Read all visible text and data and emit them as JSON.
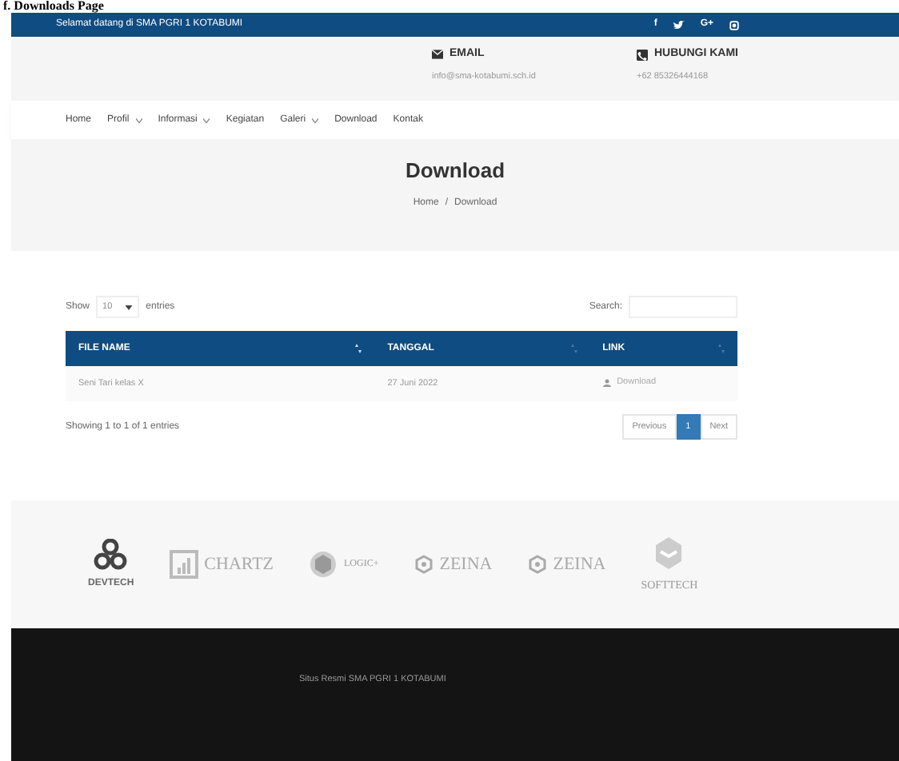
{
  "caption": "f. Downloads Page",
  "topbar": {
    "welcome": "Selamat datang di SMA PGRI 1 KOTABUMI",
    "social": [
      {
        "kind": "facebook",
        "label": "f"
      },
      {
        "kind": "twitter"
      },
      {
        "kind": "gplus",
        "label": "G+"
      },
      {
        "kind": "instagram"
      }
    ]
  },
  "contacts": [
    {
      "kind": "email",
      "title": "EMAIL",
      "value": "info@sma-kotabumi.sch.id"
    },
    {
      "kind": "phone",
      "title": "HUBUNGI KAMI",
      "value": "+62 85326444168"
    }
  ],
  "nav": [
    {
      "label": "Home",
      "dropdown": false
    },
    {
      "label": "Profil",
      "dropdown": true
    },
    {
      "label": "Informasi",
      "dropdown": true
    },
    {
      "label": "Kegiatan",
      "dropdown": false
    },
    {
      "label": "Galeri",
      "dropdown": true
    },
    {
      "label": "Download",
      "dropdown": false
    },
    {
      "label": "Kontak",
      "dropdown": false
    }
  ],
  "page_title": "Download",
  "breadcrumb": [
    "Home",
    "Download"
  ],
  "breadcrumb_separator": "/",
  "table": {
    "show_label": "Show",
    "length": "10",
    "entries_label": "entries",
    "search_label": "Search:",
    "columns": [
      "FILE NAME",
      "TANGGAL",
      "LINK"
    ],
    "rows": [
      {
        "file": "Seni Tari kelas X",
        "date": "27 Juni 2022",
        "link": "Download"
      }
    ],
    "info": "Showing 1 to 1 of 1 entries",
    "pages": [
      {
        "label": "Previous",
        "selected": false
      },
      {
        "label": "1",
        "selected": true
      },
      {
        "label": "Next",
        "selected": false
      }
    ]
  },
  "brands": [
    {
      "kind": "devtech",
      "name": "DEVTECH"
    },
    {
      "kind": "chartz",
      "name": "CHARTZ"
    },
    {
      "kind": "logic",
      "name": "LOGIC+"
    },
    {
      "kind": "zeina",
      "name": "ZEINA"
    },
    {
      "kind": "zeina",
      "name": "ZEINA"
    },
    {
      "kind": "softtech",
      "name": "SOFTTECH"
    }
  ],
  "footer": "Situs Resmi SMA PGRI 1 KOTABUMI"
}
